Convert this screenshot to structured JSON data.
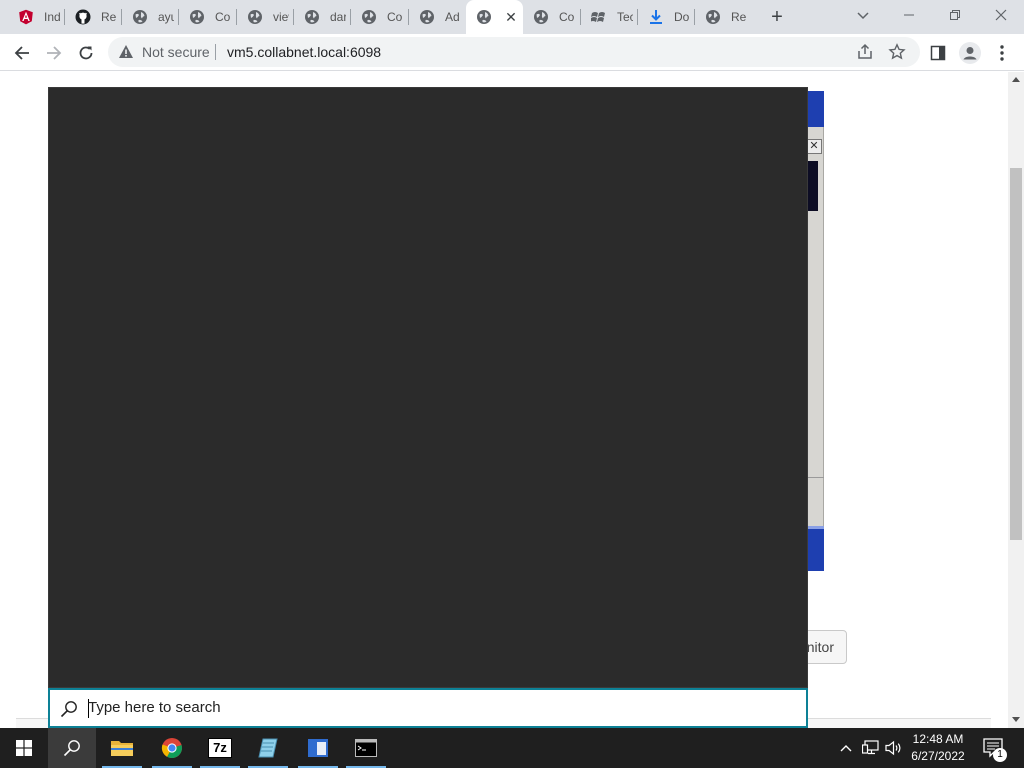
{
  "browser": {
    "tabs": [
      {
        "title": "Indi",
        "icon": "angular-icon"
      },
      {
        "title": "Rele",
        "icon": "github-icon"
      },
      {
        "title": "ayu",
        "icon": "globe-icon"
      },
      {
        "title": "Co",
        "icon": "globe-icon"
      },
      {
        "title": "view",
        "icon": "globe-icon"
      },
      {
        "title": "dar",
        "icon": "globe-icon"
      },
      {
        "title": "Co",
        "icon": "globe-icon"
      },
      {
        "title": "Ad",
        "icon": "globe-icon"
      },
      {
        "title": "",
        "icon": "globe-icon",
        "active": true
      },
      {
        "title": "Co",
        "icon": "globe-icon"
      },
      {
        "title": "Tec",
        "icon": "windows-flag-icon"
      },
      {
        "title": "Do",
        "icon": "download-icon"
      },
      {
        "title": "Re",
        "icon": "globe-icon"
      }
    ],
    "close_tab_glyph": "✕",
    "new_tab_glyph": "+",
    "omnibox": {
      "security_label": "Not secure",
      "url": "vm5.collabnet.local:6098"
    }
  },
  "page": {
    "monitor_button_label": "nitor"
  },
  "search": {
    "placeholder": "Type here to search"
  },
  "taskbar": {
    "clock_time": "12:48 AM",
    "clock_date": "6/27/2022",
    "notification_count": "1",
    "sevenzip_label": "7z"
  },
  "colors": {
    "flyout_bg": "#2b2b2b",
    "search_border": "#0d8196",
    "taskbar_bg": "#1f1f1f",
    "remote_blue": "#1e3fb0"
  }
}
